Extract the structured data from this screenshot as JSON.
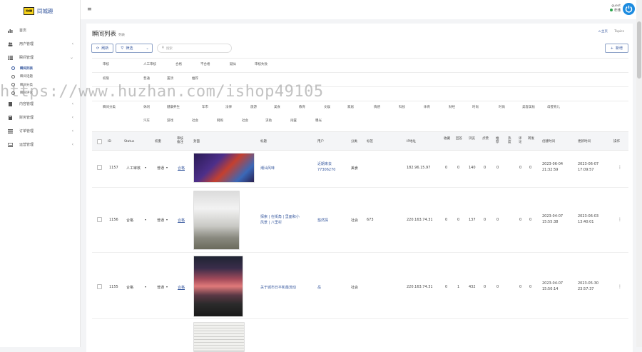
{
  "app": {
    "logo_badge": "同城趣",
    "name": "同城趣"
  },
  "sidebar": {
    "items": [
      {
        "label": "首页"
      },
      {
        "label": "用户管理"
      },
      {
        "label": "瞬间管理"
      },
      {
        "label": "内容管理"
      },
      {
        "label": "财务管理"
      },
      {
        "label": "订单管理"
      },
      {
        "label": "运营管理"
      }
    ],
    "sub_items": [
      "瞬间列表",
      "瞬间话题",
      "瞬间分类",
      "瞬间评论"
    ]
  },
  "topbar": {
    "username": "guest",
    "status": "在线"
  },
  "page": {
    "title": "瞬间列表",
    "subtitle": "列表",
    "crumb_home": "主页",
    "crumb_current": "Topics"
  },
  "toolbar": {
    "refresh": "刷新",
    "filter": "筛选",
    "search_placeholder": "搜索",
    "add": "新增"
  },
  "filters": {
    "row1": [
      "审核",
      "人工审核",
      "合格",
      "不合格",
      "疑似",
      "审核失败"
    ],
    "row2": [
      "权限",
      "普通",
      "置顶",
      "推荐"
    ],
    "row4a": [
      "瞬间分类",
      "休闲",
      "健康养生",
      "车市",
      "法律",
      "旅游",
      "美食",
      "教育",
      "文娱",
      "家居",
      "情感",
      "科技",
      "体育",
      "财经",
      "时尚",
      "时尚",
      "美容美妆",
      "母婴育儿"
    ],
    "row4b": [
      "汽车",
      "游戏",
      "社会",
      "网购",
      "社会",
      "求助",
      "闲置",
      "曝光"
    ]
  },
  "table": {
    "headers": [
      "ID",
      "Status",
      "权重",
      "审核备注",
      "封面",
      "标题",
      "用户",
      "分类",
      "标签",
      "IP地址",
      "收藏",
      "回答",
      "浏览",
      "点赞",
      "推荐",
      "热度",
      "评论",
      "转发",
      "创建时间",
      "更新时间",
      "操作"
    ],
    "rows": [
      {
        "id": "1157",
        "status": "人工审核",
        "weight": "普通",
        "audit": "合格",
        "title": "潮汕风味",
        "user": "近期来去\n77306270",
        "category": "美食",
        "tag": "",
        "ip": "182.96.15.97",
        "n1": "0",
        "n2": "0",
        "n3": "140",
        "n4": "0",
        "n5": "0",
        "n6": "0",
        "n7": "0",
        "created": "2023-06-04\n21:32:59",
        "updated": "2023-06-07\n17:09:57"
      },
      {
        "id": "1156",
        "status": "合格",
        "weight": "普通",
        "audit": "合格",
        "title": "探索 | 在街角 | 里面和小\n风景 | 八里村",
        "user": "悠然探",
        "category": "社会",
        "tag": "673",
        "ip": "220.163.74.31",
        "n1": "0",
        "n2": "0",
        "n3": "137",
        "n4": "0",
        "n5": "0",
        "n6": "0",
        "n7": "0",
        "created": "2023-04-07\n15:55:38",
        "updated": "2023-06-03\n13:40:01"
      },
      {
        "id": "1155",
        "status": "合格",
        "weight": "普通",
        "audit": "合格",
        "title": "关于城市日平和最流动",
        "user": "岳",
        "category": "社会",
        "tag": "",
        "ip": "220.163.74.31",
        "n1": "0",
        "n2": "1",
        "n3": "432",
        "n4": "0",
        "n5": "0",
        "n6": "0",
        "n7": "0",
        "created": "2023-04-07\n15:50:14",
        "updated": "2023-05-30\n23:57:37"
      }
    ]
  },
  "watermark": "https://www.huzhan.com/ishop49105"
}
